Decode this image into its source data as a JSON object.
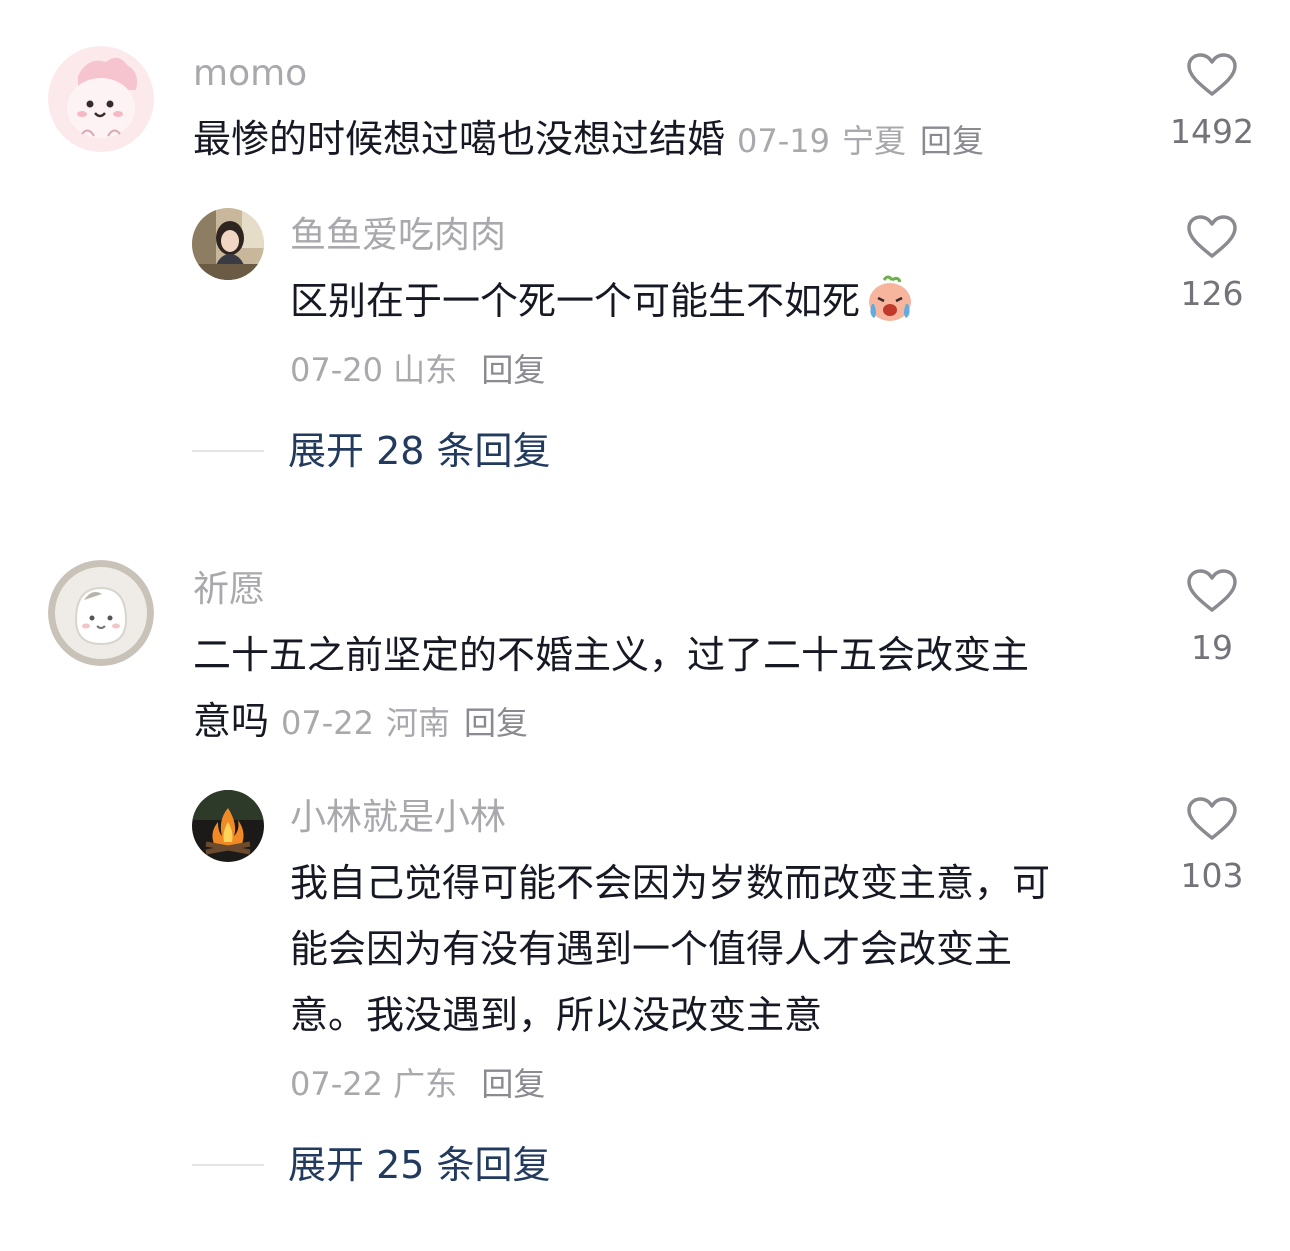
{
  "comments": [
    {
      "username": "momo",
      "text": "最惨的时候想过噶也没想过结婚",
      "date": "07-19",
      "location": "宁夏",
      "reply_label": "回复",
      "likes": "1492",
      "avatar_icon": "pink-dinosaur-avatar",
      "replies": [
        {
          "username": "鱼鱼爱吃肉肉",
          "text": "区别在于一个死一个可能生不如死",
          "emoji": "crying-face-emoji",
          "date": "07-20",
          "location": "山东",
          "reply_label": "回复",
          "likes": "126",
          "avatar_icon": "girl-photo-avatar"
        }
      ],
      "expand_label": "展开 28 条回复"
    },
    {
      "username": "祈愿",
      "text_line1": "二十五之前坚定的不婚主义，过了二十五会改变主",
      "text_line2": "意吗",
      "date": "07-22",
      "location": "河南",
      "reply_label": "回复",
      "likes": "19",
      "avatar_icon": "cartoon-cat-avatar",
      "replies": [
        {
          "username": "小林就是小林",
          "text_line1": "我自己觉得可能不会因为岁数而改变主意，可",
          "text_line2": "能会因为有没有遇到一个值得人才会改变主",
          "text_line3": "意。我没遇到，所以没改变主意",
          "date": "07-22",
          "location": "广东",
          "reply_label": "回复",
          "likes": "103",
          "avatar_icon": "campfire-avatar"
        }
      ],
      "expand_label": "展开 25 条回复"
    }
  ]
}
